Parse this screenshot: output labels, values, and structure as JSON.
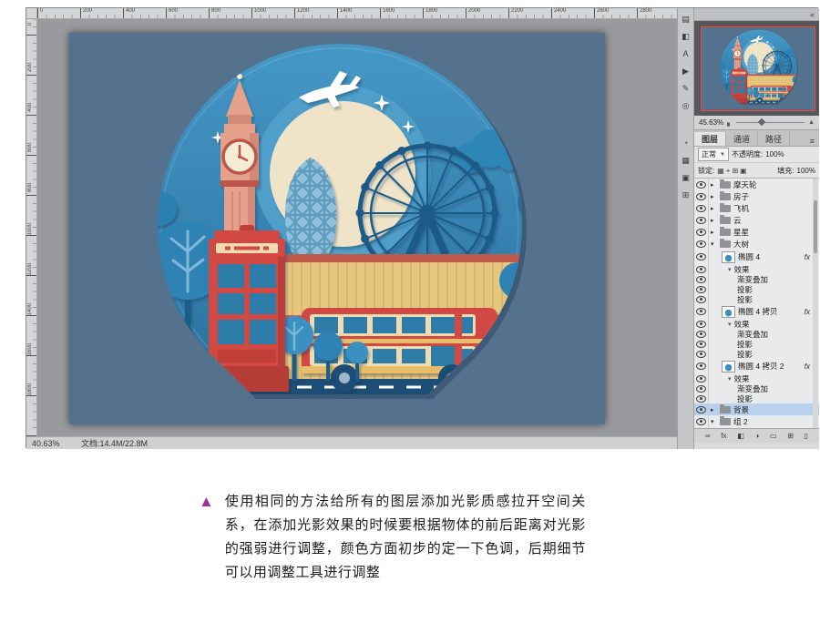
{
  "rulers": {
    "top": [
      "0",
      "200",
      "400",
      "600",
      "800",
      "1000",
      "1200",
      "1400",
      "1600",
      "1800",
      "2000",
      "2200",
      "2400",
      "2600",
      "2800"
    ],
    "left": [
      "0",
      "200",
      "400",
      "600",
      "800",
      "1000",
      "1200",
      "1400",
      "1600",
      "1800"
    ]
  },
  "status_bar": {
    "zoom": "40.63%",
    "doc_info": "文档:14.4M/22.8M"
  },
  "tool_dock": {
    "icons": [
      {
        "name": "history-panel-icon",
        "glyph": "▤"
      },
      {
        "name": "properties-panel-icon",
        "glyph": "◧"
      },
      {
        "name": "type-panel-icon",
        "glyph": "A"
      },
      {
        "name": "actions-panel-icon",
        "glyph": "▶"
      },
      {
        "name": "brush-panel-icon",
        "glyph": "✎"
      },
      {
        "name": "clone-source-panel-icon",
        "glyph": "◎"
      },
      {
        "spacer": true
      },
      {
        "name": "adjustments-panel-icon",
        "glyph": "◔"
      },
      {
        "name": "channels-grid-icon",
        "glyph": "▦"
      },
      {
        "name": "styles-panel-icon",
        "glyph": "▣"
      },
      {
        "name": "swatches-panel-icon",
        "glyph": "⊞"
      }
    ]
  },
  "collapse_bar": {
    "icon": "«"
  },
  "navigator": {
    "zoom": "45.63%",
    "zoom_out_glyph": "▖",
    "zoom_in_glyph": "▲"
  },
  "layers_panel": {
    "tabs": [
      "图层",
      "通道",
      "路径"
    ],
    "menu_icon": "≡",
    "blend_mode": "正常",
    "blend_arrow": "▼",
    "opacity_label": "不透明度:",
    "opacity_value": "100%",
    "lock_label": "锁定:",
    "lock_icons": [
      "▦",
      "+",
      "⊞",
      "▣"
    ],
    "fill_label": "填充:",
    "fill_value": "100%",
    "rows": [
      {
        "type": "group",
        "label": "摩天轮",
        "expanded": false
      },
      {
        "type": "group",
        "label": "房子",
        "expanded": false
      },
      {
        "type": "group",
        "label": "飞机",
        "expanded": false
      },
      {
        "type": "group",
        "label": "云",
        "expanded": false
      },
      {
        "type": "group",
        "label": "星星",
        "expanded": false
      },
      {
        "type": "group",
        "label": "大树",
        "expanded": true
      },
      {
        "type": "layer",
        "label": "椭圆 4",
        "fx": true
      },
      {
        "type": "fx-head",
        "label": "效果"
      },
      {
        "type": "fx",
        "label": "渐变叠加"
      },
      {
        "type": "fx",
        "label": "投影"
      },
      {
        "type": "fx",
        "label": "投影"
      },
      {
        "type": "layer",
        "label": "椭圆 4 拷贝",
        "fx": true
      },
      {
        "type": "fx-head",
        "label": "效果"
      },
      {
        "type": "fx",
        "label": "渐变叠加"
      },
      {
        "type": "fx",
        "label": "投影"
      },
      {
        "type": "fx",
        "label": "投影"
      },
      {
        "type": "layer",
        "label": "椭圆 4 拷贝 2",
        "fx": true
      },
      {
        "type": "fx-head",
        "label": "效果"
      },
      {
        "type": "fx",
        "label": "渐变叠加"
      },
      {
        "type": "fx",
        "label": "投影"
      },
      {
        "type": "group",
        "label": "背景",
        "expanded": false,
        "selected": true
      },
      {
        "type": "group",
        "label": "组 2",
        "expanded": true
      }
    ],
    "bottom_icons": [
      {
        "name": "link-layers-icon",
        "glyph": "∞"
      },
      {
        "name": "layer-style-icon",
        "glyph": "fx"
      },
      {
        "name": "layer-mask-icon",
        "glyph": "◧"
      },
      {
        "name": "adjustment-layer-icon",
        "glyph": "◑"
      },
      {
        "name": "layer-group-icon",
        "glyph": "▭"
      },
      {
        "name": "new-layer-icon",
        "glyph": "⊞"
      },
      {
        "name": "delete-layer-icon",
        "glyph": "▯"
      }
    ]
  },
  "caption": {
    "bullet": "▲",
    "text": "使用相同的方法给所有的图层添加光影质感拉开空间关系，在添加光影效果的时候要根据物体的前后距离对光影的强弱进行调整，颜色方面初步的定一下色调，后期细节可以用调整工具进行调整"
  },
  "ui_colors": {
    "selection": "#b8d2ee",
    "caption_bullet": "#a0309a",
    "navigator_border": "#ff4438"
  },
  "palette": {
    "bg": "#54718e",
    "badge_top": "#4598c6",
    "badge_bottom": "#2a6f9e",
    "badge_shadow": "#16304a",
    "halo": "#4f9fca",
    "moon": "#efe4c8",
    "white": "#ffffff",
    "cloud": "#2b81b1",
    "cloud2": "#2e86b6",
    "cloud_dark": "#256f9e",
    "salmon": "#e5a18b",
    "salmon_dark": "#d18b78",
    "red": "#d14a42",
    "red_deep": "#c03f38",
    "red_dark": "#b53c35",
    "maroon": "#bb564c",
    "coping": "#bf5a4b",
    "cream": "#f0dcae",
    "clockface": "#f6ecd4",
    "wall": "#e6c77f",
    "wall_stripe": "#d4ab62",
    "yellow": "#e8bd6a",
    "navy": "#1f5a88",
    "window_blue": "#2f7ba8",
    "tree1": "#2e83b4",
    "tree2": "#3b90c1",
    "trunk": "#1c5b87",
    "vein": "#7fb8d8",
    "road": "#1d4e75",
    "wheel_hub": "#9db8cc",
    "gherkin": "#8fc0db",
    "gherkin_line": "#5e9bbd"
  }
}
